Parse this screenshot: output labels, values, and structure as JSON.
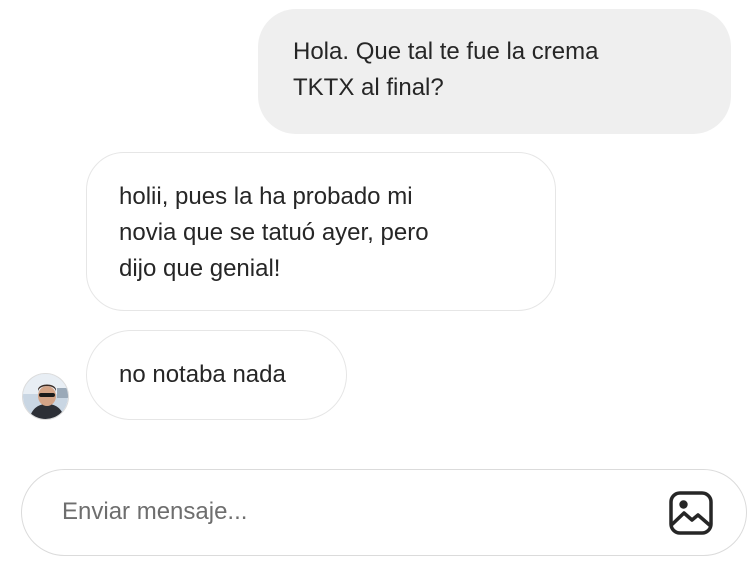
{
  "conversation": {
    "messages": [
      {
        "direction": "outgoing",
        "text": "Hola. Que tal te fue la crema\nTKTX al final?"
      },
      {
        "direction": "incoming",
        "text": "holii, pues la ha probado mi\nnovia que se tatuó ayer, pero\ndijo que genial!"
      },
      {
        "direction": "incoming",
        "text": "no notaba nada"
      }
    ]
  },
  "composer": {
    "placeholder": "Enviar mensaje...",
    "value": "",
    "attach_icon": "image-icon"
  },
  "colors": {
    "outgoing_bubble": "#efefef",
    "incoming_border": "#e6e6e6",
    "text": "#262626",
    "placeholder": "#6e6e6e"
  }
}
